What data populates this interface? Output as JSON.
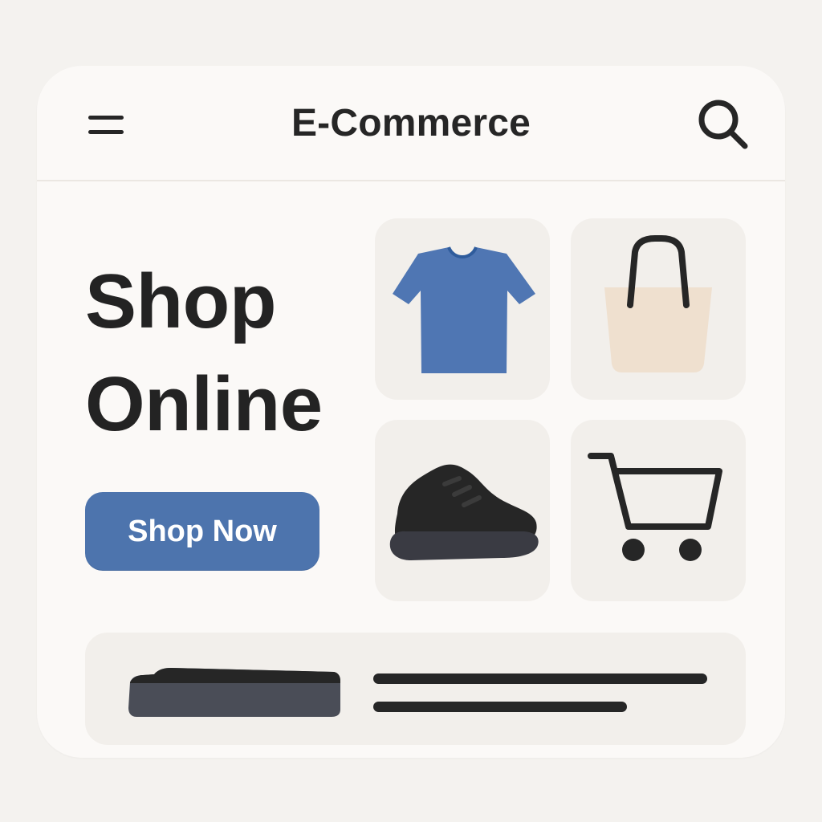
{
  "header": {
    "title": "E-Commerce",
    "menu_icon": "menu-icon",
    "search_icon": "search-icon"
  },
  "hero": {
    "title_line_1": "Shop",
    "title_line_2": "Online",
    "button_label": "Shop Now"
  },
  "categories": [
    {
      "icon": "tshirt-icon"
    },
    {
      "icon": "shopping-bag-icon"
    },
    {
      "icon": "sneaker-icon"
    },
    {
      "icon": "shopping-cart-icon"
    }
  ],
  "bottom_banner": {
    "icon": "shoe-icon"
  },
  "colors": {
    "page_background": "#f4f2ef",
    "card_background": "#fbf9f7",
    "tile_background": "#f2efeb",
    "primary": "#4d74ad",
    "tshirt": "#4f76b3",
    "bag": "#efe0cf",
    "dark": "#262626"
  }
}
